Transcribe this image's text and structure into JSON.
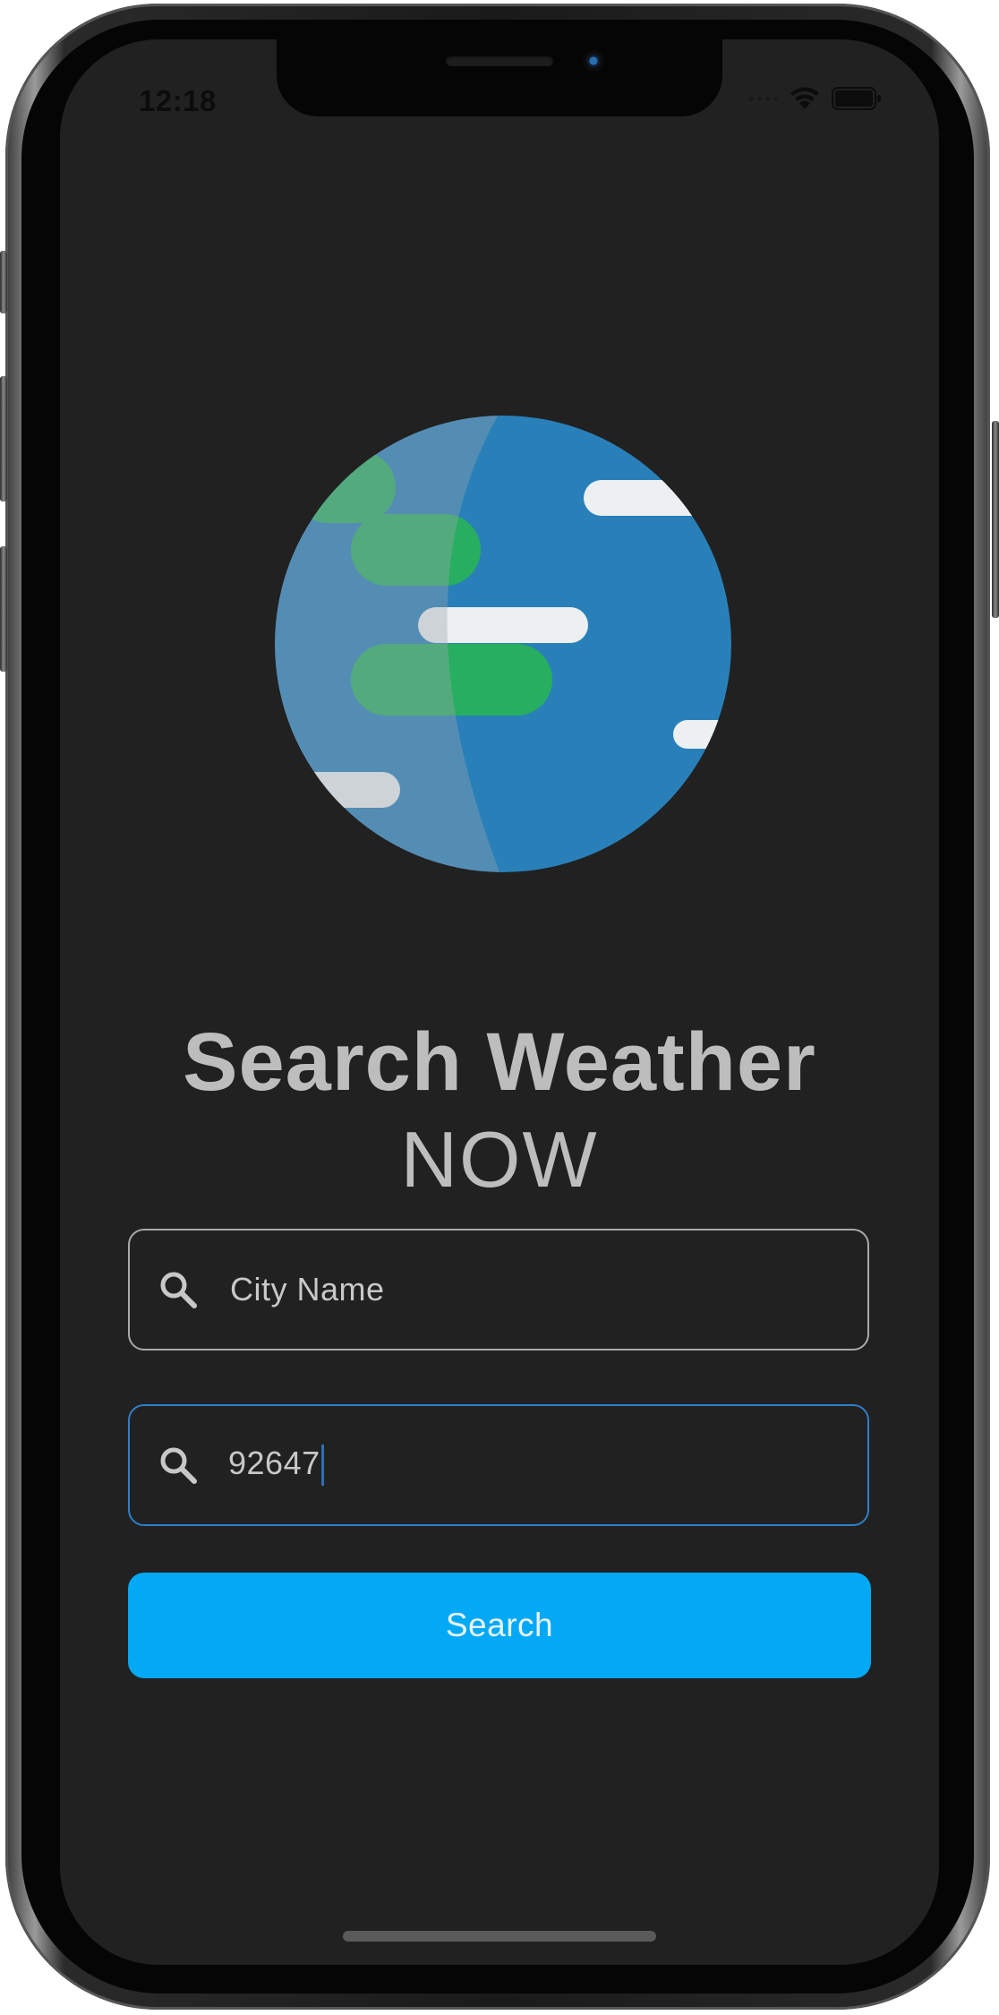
{
  "status_bar": {
    "time": "12:18",
    "wifi_icon": "wifi-icon",
    "battery_icon": "battery-icon"
  },
  "hero": {
    "illustration": "globe-icon",
    "title": "Search Weather",
    "subtitle": "NOW"
  },
  "form": {
    "city_field": {
      "icon": "search-icon",
      "placeholder": "City Name",
      "value": ""
    },
    "zip_field": {
      "icon": "search-icon",
      "value": "92647",
      "focused": true
    },
    "submit_label": "Search"
  },
  "colors": {
    "background": "#212121",
    "accent": "#03a9f4",
    "focus_border": "#2f7fc9",
    "text": "#bdbdbd",
    "globe_ocean": "#2980b9",
    "globe_land": "#27ae60"
  }
}
